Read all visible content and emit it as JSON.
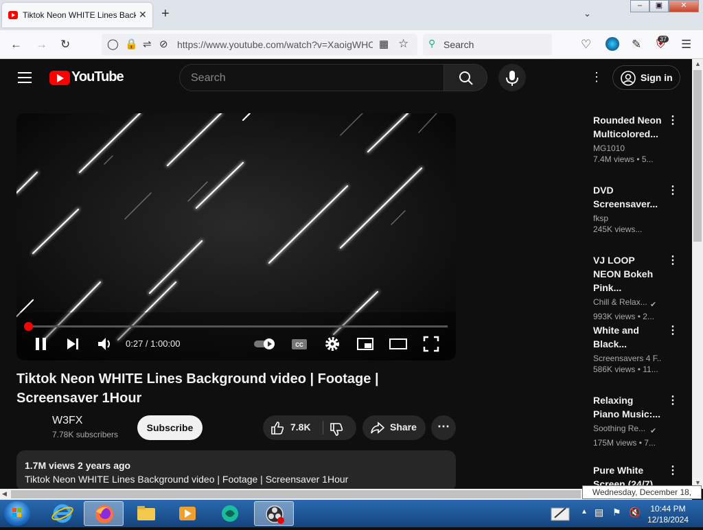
{
  "browser": {
    "tab_title": "Tiktok Neon WHITE Lines Background video | Footage | Screensaver 1Hour",
    "url": "https://www.youtube.com/watch?v=XaoigWHC",
    "search_placeholder": "Search",
    "extension_badge": "37"
  },
  "youtube": {
    "logo_text": "YouTube",
    "search_placeholder": "Search",
    "sign_in": "Sign in"
  },
  "player": {
    "time": "0:27 / 1:00:00",
    "progress_fraction": 0.0075
  },
  "video": {
    "title": "Tiktok Neon WHITE Lines Background video | Footage | Screensaver 1Hour",
    "channel": "W3FX",
    "subscribers": "7.78K subscribers",
    "subscribe": "Subscribe",
    "likes": "7.8K",
    "share": "Share",
    "views_age": "1.7M views  2 years ago",
    "description": "Tiktok Neon WHITE Lines Background video | Footage | Screensaver 1Hour"
  },
  "sidebar": [
    {
      "title": "Rounded Neon Multicolored...",
      "channel": "MG1010",
      "meta": "7.4M views • 5..."
    },
    {
      "title": "DVD Screensaver...",
      "channel": "fksp",
      "meta": "245K views..."
    },
    {
      "title": "VJ LOOP NEON Bokeh Pink...",
      "channel": "Chill & Relax...",
      "meta": "993K views • 2..."
    },
    {
      "title": "White and Black...",
      "channel": "Screensavers 4 F...",
      "meta": "586K views • 11..."
    },
    {
      "title": "Relaxing Piano Music:...",
      "channel": "Soothing Re...",
      "meta": "175M views • 7..."
    },
    {
      "title": "Pure White Screen (24/7)",
      "channel": "",
      "meta": ""
    }
  ],
  "tooltip": "Wednesday, December 18, 2024",
  "taskbar": {
    "time": "10:44 PM",
    "date": "12/18/2024"
  }
}
